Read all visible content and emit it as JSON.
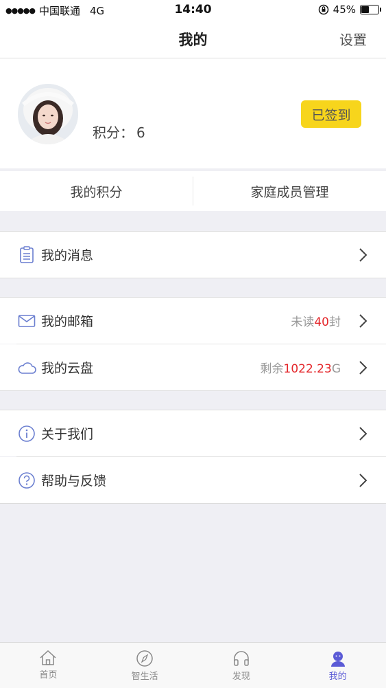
{
  "status_bar": {
    "carrier": "中国联通",
    "network": "4G",
    "time": "14:40",
    "battery_text": "45%",
    "battery_level": 0.45
  },
  "nav": {
    "title": "我的",
    "settings_label": "设置"
  },
  "profile": {
    "points_label": "积分：",
    "points_value": "6",
    "checkin_label": "已签到"
  },
  "tabs": [
    {
      "label": "我的积分"
    },
    {
      "label": "家庭成员管理"
    }
  ],
  "menu": {
    "messages": {
      "label": "我的消息",
      "icon": "clipboard-icon"
    },
    "mailbox": {
      "label": "我的邮箱",
      "icon": "envelope-icon",
      "detail_prefix": "未读",
      "detail_value": "40",
      "detail_suffix": "封"
    },
    "cloud": {
      "label": "我的云盘",
      "icon": "cloud-icon",
      "detail_prefix": "剩余",
      "detail_value": "1022.23",
      "detail_suffix": "G"
    },
    "about": {
      "label": "关于我们",
      "icon": "info-icon"
    },
    "help": {
      "label": "帮助与反馈",
      "icon": "question-icon"
    }
  },
  "tab_bar": [
    {
      "label": "首页",
      "icon": "home-icon"
    },
    {
      "label": "智生活",
      "icon": "compass-icon"
    },
    {
      "label": "发现",
      "icon": "headphones-icon"
    },
    {
      "label": "我的",
      "icon": "user-icon",
      "active": true
    }
  ],
  "colors": {
    "accent": "#5b5bd6",
    "checkin": "#f7d51c",
    "highlight_number": "#e4262a",
    "background": "#efeff4"
  }
}
